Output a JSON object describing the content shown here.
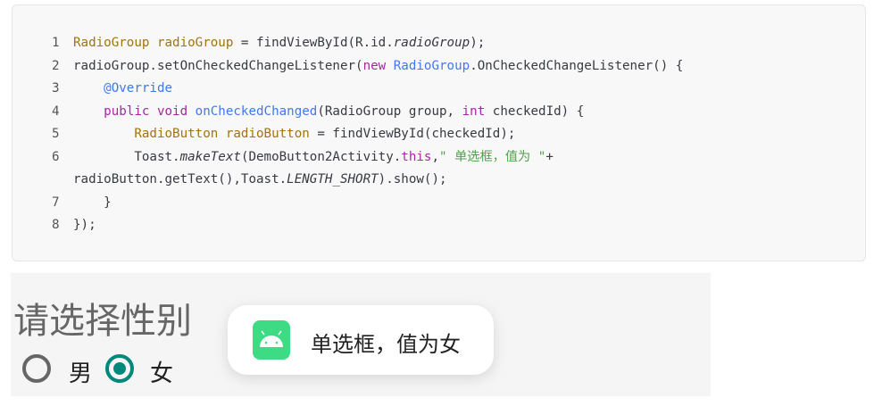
{
  "code": {
    "lines": [
      {
        "n": "1",
        "parts": [
          [
            "t",
            "RadioGroup radioGroup"
          ],
          [
            "",
            "= findViewById(R.id."
          ],
          [
            "i",
            "radioGroup"
          ],
          [
            "",
            ");"
          ]
        ]
      },
      {
        "n": "2",
        "parts": [
          [
            "",
            "radioGroup.setOnCheckedChangeListener("
          ],
          [
            "k",
            "new "
          ],
          [
            "f",
            "RadioGroup"
          ],
          [
            "",
            ".OnCheckedChangeListener() {"
          ]
        ]
      },
      {
        "n": "3",
        "parts": [
          [
            "",
            "    "
          ],
          [
            "f",
            "@Override"
          ]
        ]
      },
      {
        "n": "4",
        "parts": [
          [
            "",
            "    "
          ],
          [
            "k",
            "public void "
          ],
          [
            "f",
            "onCheckedChanged"
          ],
          [
            "",
            "(RadioGroup group, "
          ],
          [
            "k",
            "int"
          ],
          [
            "",
            " checkedId) {"
          ]
        ]
      },
      {
        "n": "5",
        "parts": [
          [
            "",
            "        "
          ],
          [
            "t",
            "RadioButton radioButton"
          ],
          [
            "",
            " = findViewById(checkedId);"
          ]
        ]
      },
      {
        "n": "6",
        "parts": [
          [
            "",
            "        Toast."
          ],
          [
            "i",
            "makeText"
          ],
          [
            "",
            "(DemoButton2Activity."
          ],
          [
            "k",
            "this"
          ],
          [
            "",
            ","
          ],
          [
            "s",
            "\" 单选框，值为 \""
          ],
          [
            "",
            "+"
          ]
        ]
      },
      {
        "n": "",
        "parts": [
          [
            "",
            "radioButton.getText(),Toast."
          ],
          [
            "i",
            "LENGTH_SHORT"
          ],
          [
            "",
            ").show();"
          ]
        ]
      },
      {
        "n": "7",
        "parts": [
          [
            "",
            "    }"
          ]
        ]
      },
      {
        "n": "8",
        "parts": [
          [
            "",
            "});"
          ]
        ]
      }
    ]
  },
  "demo": {
    "title": "请选择性别",
    "options": [
      {
        "label": "男",
        "checked": false
      },
      {
        "label": "女",
        "checked": true
      }
    ],
    "accent": "#00897b"
  },
  "toast": {
    "icon": "android-app-icon",
    "text": "单选框，值为女"
  }
}
